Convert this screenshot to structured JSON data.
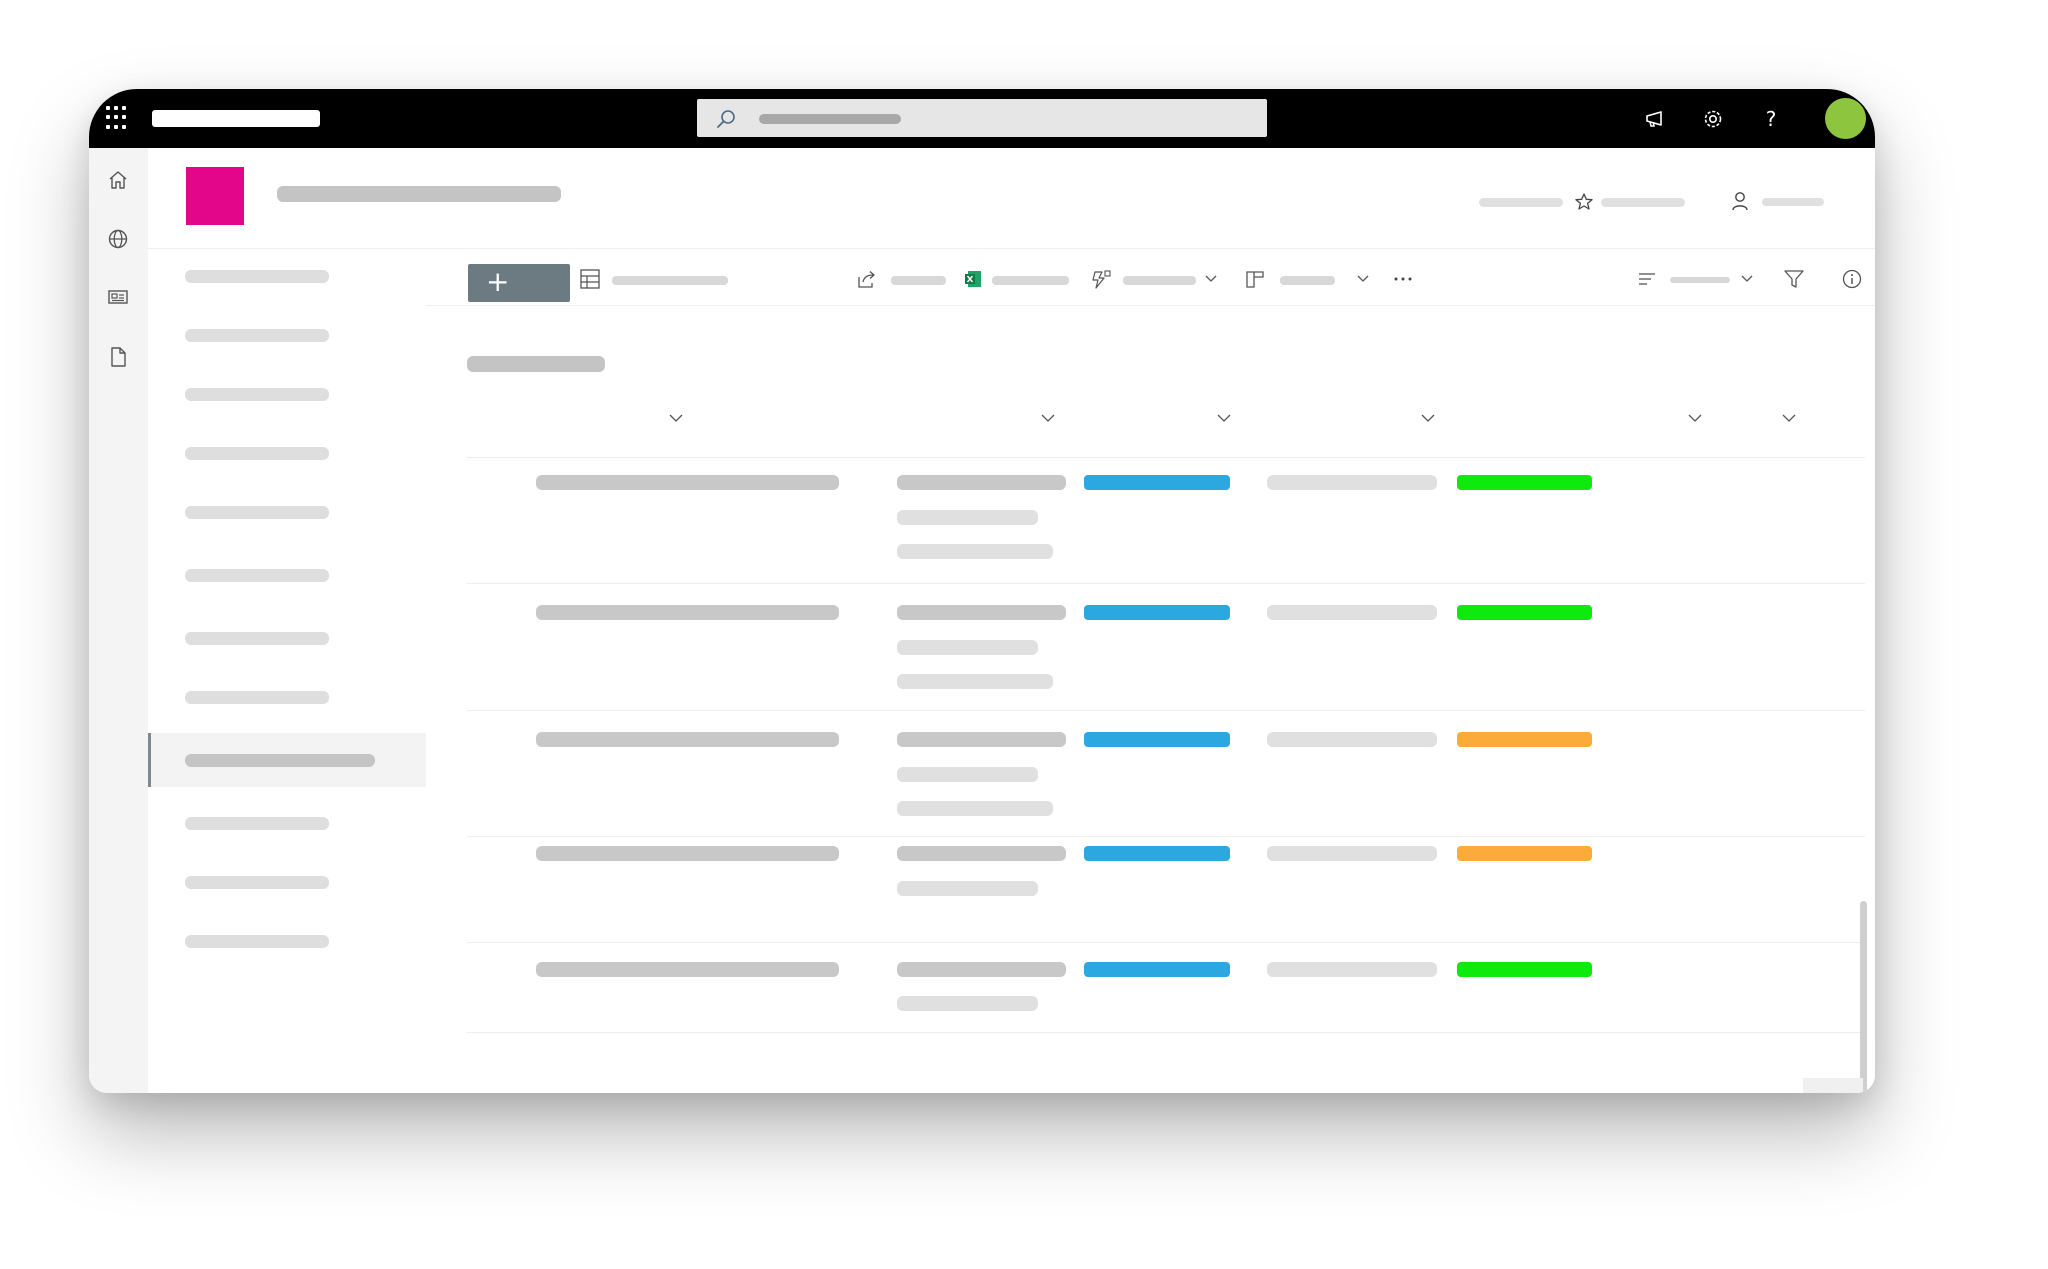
{
  "colors": {
    "topbar": "#000000",
    "site_logo": "#e3068b",
    "avatar": "#8dc53e",
    "new_button": "#6c7a81",
    "status_blue": "#2ba8e0",
    "status_green": "#0eea0e",
    "status_orange": "#fbab3a"
  },
  "topbar": {
    "icons": [
      "app-launcher-icon",
      "search-icon",
      "megaphone-icon",
      "gear-icon",
      "help-icon"
    ],
    "search": {
      "value": "",
      "placeholder": ""
    }
  },
  "rail": {
    "icons": [
      "home-icon",
      "globe-icon",
      "news-icon",
      "document-icon"
    ]
  },
  "navigation": {
    "item_count": 12,
    "active_index": 8
  },
  "command_bar": {
    "new_label": "+",
    "icons": [
      "grid-view-icon",
      "share-icon",
      "excel-icon",
      "automate-icon",
      "board-icon",
      "more-icon",
      "sort-icon",
      "filter-icon",
      "info-icon",
      "expand-icon"
    ]
  },
  "list": {
    "rows": [
      {
        "status_color": "green",
        "detail_lines": 3
      },
      {
        "status_color": "green",
        "detail_lines": 3
      },
      {
        "status_color": "orange",
        "detail_lines": 3
      },
      {
        "status_color": "orange",
        "detail_lines": 2
      },
      {
        "status_color": "green",
        "detail_lines": 2
      }
    ]
  }
}
